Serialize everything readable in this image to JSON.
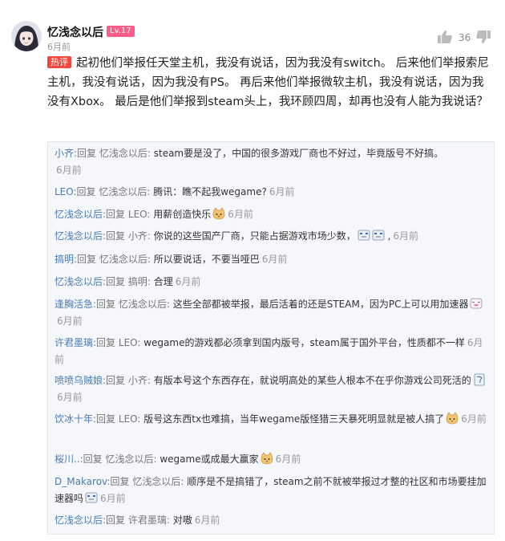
{
  "comment": {
    "username": "忆浅念以后",
    "level": "Lv.17",
    "time": "6月前",
    "likes": "36",
    "hot_tag": "热评",
    "text": "起初他们举报任天堂主机，我没有说话，因为我没有switch。 后来他们举报索尼主机，我没有说话，因为我没有PS。 再后来他们举报微软主机，我没有说话，因为我没有Xbox。 最后是他们举报到steam头上，我环顾四周，却再也没有人能为我说话？"
  },
  "replies": [
    {
      "name": "小齐",
      "label": ":回复",
      "target": "忆浅念以后:",
      "text": " steam要是没了，中国的很多游戏厂商也不好过，毕竟版号不好搞。",
      "time": "6月前"
    },
    {
      "name": "LEO",
      "label": ":回复",
      "target": "忆浅念以后:",
      "text": " 腾讯：瞧不起我wegame?",
      "time": "6月前"
    },
    {
      "name": "忆浅念以后",
      "label": ":回复",
      "target": "LEO:",
      "text": " 用薪创造快乐",
      "time": "6月前",
      "emoji": "cat-face"
    },
    {
      "name": "忆浅念以后",
      "label": ":回复",
      "target": "小齐:",
      "text": " 你说的这些国产厂商，只能占据游戏市场少数，",
      "time": "6月前",
      "emoji": "tv-face-pair"
    },
    {
      "name": "搞明",
      "label": ":回复",
      "target": "忆浅念以后:",
      "text": " 所以要说话，不要当哑巴",
      "time": "6月前"
    },
    {
      "name": "忆浅念以后",
      "label": ":回复",
      "target": "搞明:",
      "text": " 合理",
      "time": "6月前"
    },
    {
      "name": "逢胸活急",
      "label": ":回复",
      "target": "忆浅念以后:",
      "text": " 这些全部都被举报，最后活着的还是STEAM，因为PC上可以用加速器",
      "time": "6月前",
      "emoji": "laugh-face"
    },
    {
      "name": "许君墨璃",
      "label": ":回复",
      "target": "LEO:",
      "text": " wegame的游戏都必须拿到国内版号，steam属于国外平台，性质都不一样",
      "time": "6月前"
    },
    {
      "name": "喷喷乌贼娘",
      "label": ":回复",
      "target": "小齐:",
      "text": " 有版本号这个东西存在，就说明高处的某些人根本不在乎你游戏公司死活的",
      "time": "6月前",
      "emoji": "doc-face"
    },
    {
      "name": "饮冰十年",
      "label": ":回复",
      "target": "LEO:",
      "text": " 版号这东西tx也难搞，当年wegame版怪猎三天暴死明显就是被人搞了",
      "time": "6月前",
      "emoji": "cat-face"
    },
    {
      "name": "桜川..",
      "label": ":回复",
      "target": "忆浅念以后:",
      "text": " wegame或成最大赢家",
      "time": "6月前",
      "emoji": "cat-face"
    },
    {
      "name": "D_Makarov",
      "label": ":回复",
      "target": "忆浅念以后:",
      "text": " 顺序是不是搞错了，steam之前不就被举报过才整的社区和市场要挂加速器吗",
      "time": "6月前",
      "emoji": "tv-face"
    },
    {
      "name": "忆浅念以后",
      "label": ":回复",
      "target": "许君墨璃:",
      "text": " 对嗷",
      "time": "6月前"
    }
  ]
}
